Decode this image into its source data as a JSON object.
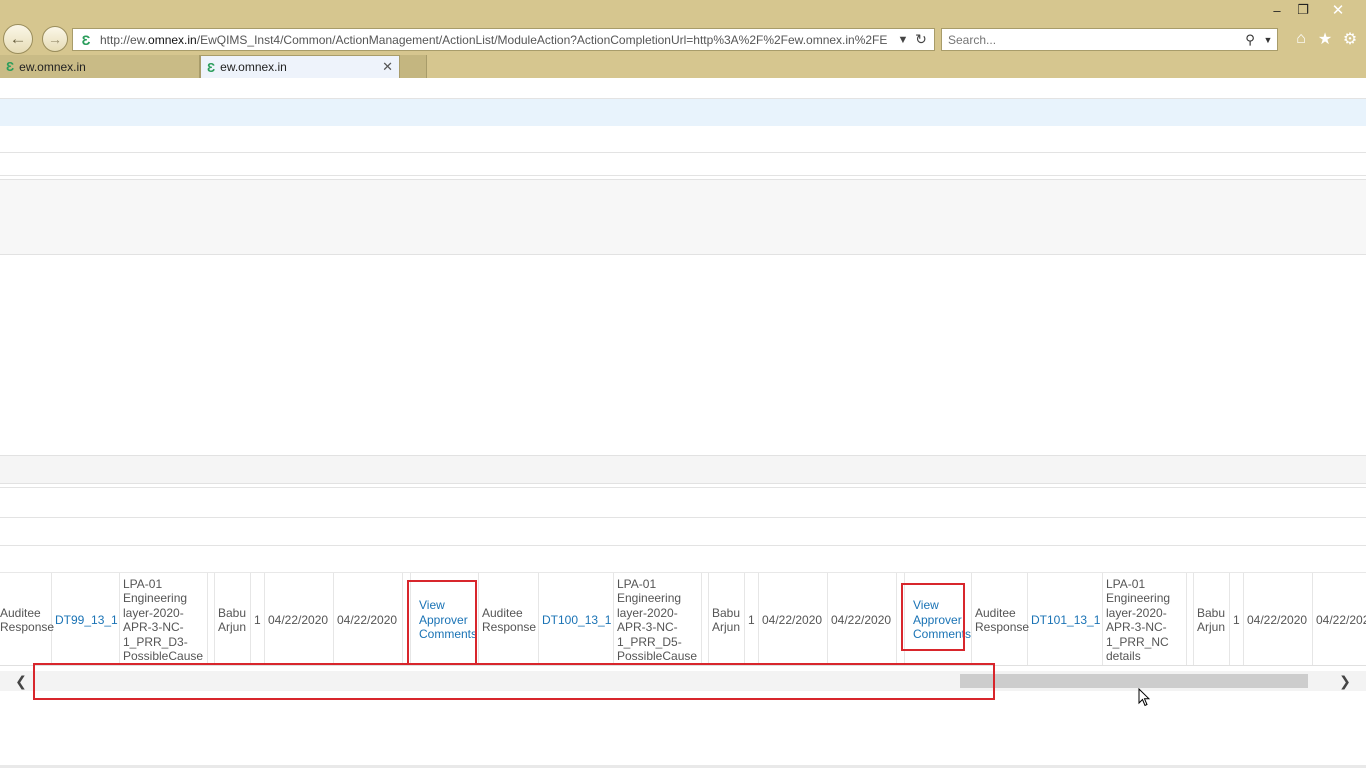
{
  "browser": {
    "url_prefix": "http://ew.",
    "url_domain": "omnex.in",
    "url_rest": "/EwQIMS_Inst4/Common/ActionManagement/ActionList/ModuleAction?ActionCompletionUrl=http%3A%2F%2Few.omnex.in%2FE",
    "search_placeholder": "Search...",
    "tabs": [
      {
        "label": "ew.omnex.in"
      },
      {
        "label": "ew.omnex.in"
      }
    ],
    "accent": "#d6c68f"
  },
  "grid": {
    "rows": [
      {
        "response_type": "Auditee Response",
        "id": "DT99_13_1",
        "description": "LPA-01 Engineering layer-2020-APR-3-NC-1_PRR_D3-PossibleCause",
        "owner": "Babu Arjun",
        "count": "1",
        "date1": "04/22/2020",
        "date2": "04/22/2020",
        "comments_link": "View Approver Comments"
      },
      {
        "response_type": "Auditee Response",
        "id": "DT100_13_1",
        "description": "LPA-01 Engineering layer-2020-APR-3-NC-1_PRR_D5-PossibleCause",
        "owner": "Babu Arjun",
        "count": "1",
        "date1": "04/22/2020",
        "date2": "04/22/2020",
        "comments_link": "View Approver Comments"
      },
      {
        "response_type": "Auditee Response",
        "id": "DT101_13_1",
        "description": "LPA-01 Engineering layer-2020-APR-3-NC-1_PRR_NC details",
        "owner": "Babu Arjun",
        "count": "1",
        "date1": "04/22/2020",
        "date2": "04/22/202"
      }
    ]
  },
  "icons": {
    "back": "back-arrow-icon",
    "forward": "forward-arrow-icon",
    "home": "home-icon",
    "favorites": "star-icon",
    "settings": "gear-icon"
  },
  "highlight_color": "#d8262c"
}
